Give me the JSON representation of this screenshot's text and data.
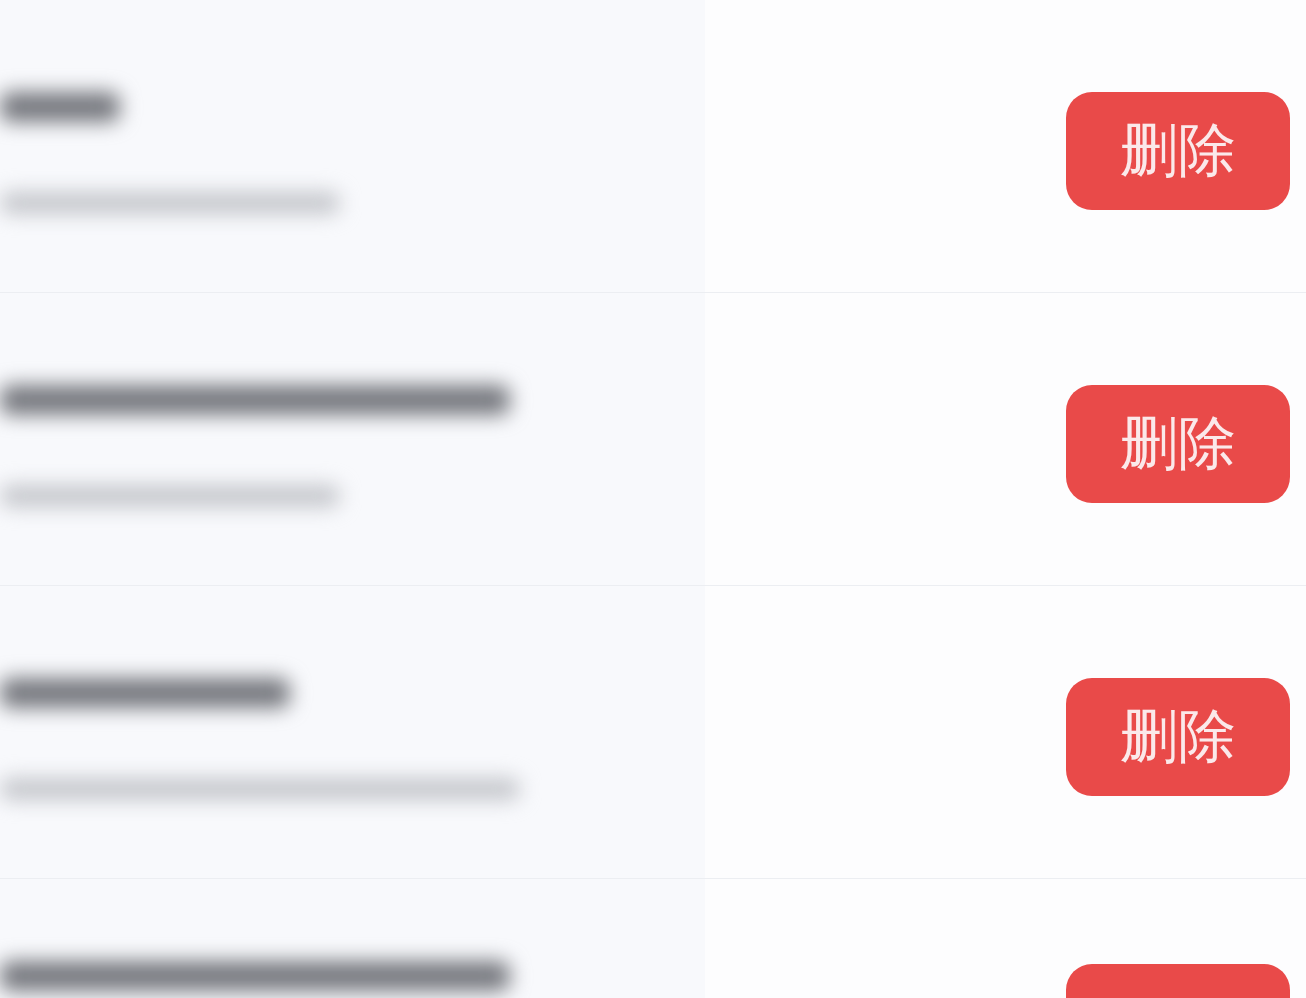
{
  "rows": [
    {
      "delete_label": "删除"
    },
    {
      "delete_label": "删除"
    },
    {
      "delete_label": "删除"
    },
    {}
  ]
}
